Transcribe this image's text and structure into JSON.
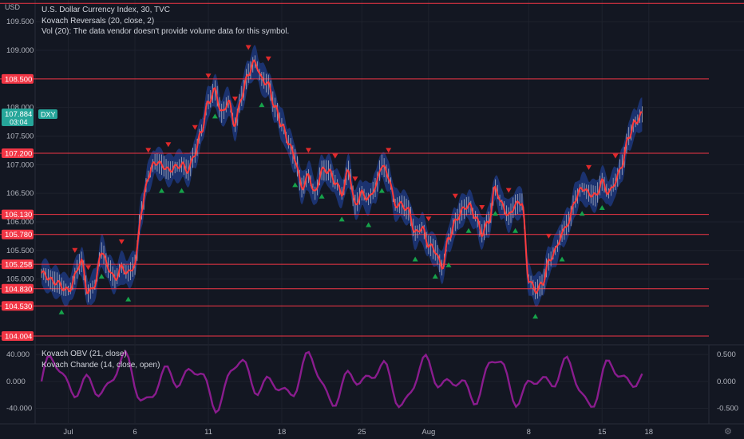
{
  "legend": {
    "line1": "U.S. Dollar Currency Index, 30, TVC",
    "line2": "Kovach Reversals (20, close, 2)",
    "line3": "Vol (20): The data vendor doesn't provide volume data for this symbol."
  },
  "lower_legend": {
    "line1": "Kovach OBV (21, close)",
    "line2": "Kovach Chande (14, close, open)"
  },
  "currency_label": "USD",
  "price_badge": {
    "symbol": "DXY",
    "price": "107.884",
    "countdown": "03:04"
  },
  "chart_data": {
    "type": "line",
    "main": {
      "ylim": [
        103.85,
        109.88
      ],
      "ticks": [
        "109.500",
        "109.000",
        "108.000",
        "107.500",
        "107.000",
        "106.500",
        "106.000",
        "105.500",
        "105.000"
      ],
      "tick_values": [
        109.5,
        109.0,
        108.0,
        107.5,
        107.0,
        106.5,
        106.0,
        105.5,
        105.0
      ],
      "levels": [
        {
          "label": "108.500",
          "value": 108.5
        },
        {
          "label": "107.200",
          "value": 107.2
        },
        {
          "label": "106.130",
          "value": 106.13
        },
        {
          "label": "105.780",
          "value": 105.78
        },
        {
          "label": "105.258",
          "value": 105.258
        },
        {
          "label": "104.830",
          "value": 104.83
        },
        {
          "label": "104.530",
          "value": 104.53
        },
        {
          "label": "104.004",
          "value": 104.004
        }
      ],
      "top_level": 109.82,
      "x_index_range": [
        0,
        100
      ],
      "series_close": [
        [
          0,
          105.1
        ],
        [
          2,
          104.95
        ],
        [
          4,
          104.8
        ],
        [
          6,
          105.3
        ],
        [
          7,
          104.75
        ],
        [
          8,
          104.9
        ],
        [
          9,
          105.5
        ],
        [
          10,
          105.2
        ],
        [
          11,
          105.0
        ],
        [
          12,
          105.2
        ],
        [
          13,
          105.1
        ],
        [
          14,
          105.25
        ],
        [
          15,
          106.2
        ],
        [
          16,
          106.8
        ],
        [
          17,
          107.05
        ],
        [
          18,
          107.0
        ],
        [
          19,
          106.9
        ],
        [
          20,
          106.95
        ],
        [
          21,
          107.0
        ],
        [
          22,
          106.9
        ],
        [
          23,
          107.2
        ],
        [
          24,
          107.6
        ],
        [
          25,
          108.1
        ],
        [
          26,
          108.3
        ],
        [
          27,
          107.9
        ],
        [
          28,
          108.1
        ],
        [
          29,
          107.7
        ],
        [
          30,
          108.2
        ],
        [
          31,
          108.6
        ],
        [
          32,
          108.8
        ],
        [
          33,
          108.5
        ],
        [
          34,
          108.4
        ],
        [
          35,
          108.0
        ],
        [
          36,
          107.7
        ],
        [
          37,
          107.4
        ],
        [
          38,
          107.1
        ],
        [
          39,
          106.6
        ],
        [
          40,
          106.8
        ],
        [
          41,
          106.5
        ],
        [
          42,
          106.9
        ],
        [
          43,
          106.9
        ],
        [
          44,
          106.7
        ],
        [
          45,
          106.5
        ],
        [
          46,
          106.9
        ],
        [
          47,
          106.3
        ],
        [
          48,
          106.5
        ],
        [
          49,
          106.4
        ],
        [
          50,
          106.6
        ],
        [
          51,
          107.0
        ],
        [
          52,
          106.8
        ],
        [
          53,
          106.3
        ],
        [
          54,
          106.3
        ],
        [
          55,
          106.2
        ],
        [
          56,
          105.8
        ],
        [
          57,
          105.9
        ],
        [
          58,
          105.6
        ],
        [
          59,
          105.5
        ],
        [
          60,
          105.2
        ],
        [
          61,
          105.7
        ],
        [
          62,
          106.0
        ],
        [
          63,
          106.2
        ],
        [
          64,
          106.3
        ],
        [
          65,
          106.1
        ],
        [
          66,
          105.8
        ],
        [
          67,
          106.0
        ],
        [
          68,
          106.6
        ],
        [
          69,
          106.3
        ],
        [
          70,
          106.1
        ],
        [
          71,
          106.3
        ],
        [
          72,
          106.35
        ],
        [
          73,
          105.0
        ],
        [
          74,
          104.8
        ],
        [
          75,
          104.9
        ],
        [
          76,
          105.3
        ],
        [
          77,
          105.5
        ],
        [
          78,
          105.8
        ],
        [
          79,
          106.0
        ],
        [
          80,
          106.4
        ],
        [
          81,
          106.6
        ],
        [
          82,
          106.5
        ],
        [
          83,
          106.45
        ],
        [
          84,
          106.7
        ],
        [
          85,
          106.5
        ],
        [
          86,
          106.7
        ],
        [
          87,
          107.0
        ],
        [
          88,
          107.5
        ],
        [
          89,
          107.75
        ],
        [
          90,
          107.88
        ]
      ],
      "sell_markers_x": [
        5,
        7,
        12,
        16,
        19,
        23,
        25,
        29,
        31,
        34,
        40,
        44,
        47,
        52,
        58,
        62,
        66,
        70,
        76,
        82,
        86
      ],
      "buy_markers_x": [
        3,
        9,
        13,
        18,
        21,
        26,
        33,
        38,
        42,
        45,
        49,
        51,
        56,
        59,
        61,
        64,
        68,
        71,
        74,
        78,
        81,
        84
      ]
    },
    "lower": {
      "ylim": [
        -62,
        52
      ],
      "left_ticks": [
        "40.000",
        "0.000",
        "-40.000"
      ],
      "left_tick_values": [
        40,
        0,
        -40
      ],
      "right_ticks": [
        "0.500",
        "0.000",
        "-0.500"
      ]
    },
    "x_axis": {
      "labels": [
        {
          "label": "Jul",
          "i": 4
        },
        {
          "label": "6",
          "i": 14
        },
        {
          "label": "11",
          "i": 25
        },
        {
          "label": "18",
          "i": 36
        },
        {
          "label": "25",
          "i": 48
        },
        {
          "label": "Aug",
          "i": 58
        },
        {
          "label": "8",
          "i": 73
        },
        {
          "label": "15",
          "i": 84
        },
        {
          "label": "18",
          "i": 91
        }
      ]
    },
    "colors": {
      "close": "#ff3b3b",
      "band": "#1f3c8a",
      "level": "#f23645",
      "sell": "#e0292b",
      "buy": "#16a34a",
      "obv": "#8a1c8e",
      "badge": "#26a69a"
    }
  },
  "icons": {
    "settings": "gear-icon"
  }
}
